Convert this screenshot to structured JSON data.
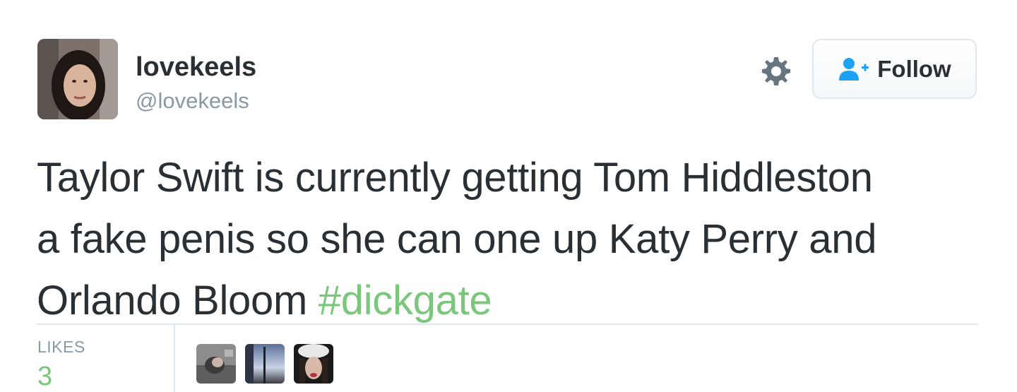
{
  "user": {
    "display_name": "lovekeels",
    "handle": "@lovekeels",
    "avatar_icon": "user-avatar"
  },
  "actions": {
    "settings_icon": "gear-icon",
    "follow_icon": "add-user-icon",
    "follow_label": "Follow"
  },
  "tweet": {
    "lines": [
      "Taylor Swift is currently getting Tom Hiddleston",
      "a fake penis so she can one up Katy Perry and",
      "Orlando Bloom "
    ],
    "hashtag": "#dickgate"
  },
  "stats": {
    "likes_label": "LIKES",
    "likes_count": "3"
  },
  "likers": [
    {
      "icon": "liker-avatar-1"
    },
    {
      "icon": "liker-avatar-2"
    },
    {
      "icon": "liker-avatar-3"
    }
  ],
  "colors": {
    "text": "#292f33",
    "muted": "#8899a6",
    "hashtag": "#7ac77b",
    "follow_icon": "#1da1f2",
    "border": "#e1e8ed"
  }
}
